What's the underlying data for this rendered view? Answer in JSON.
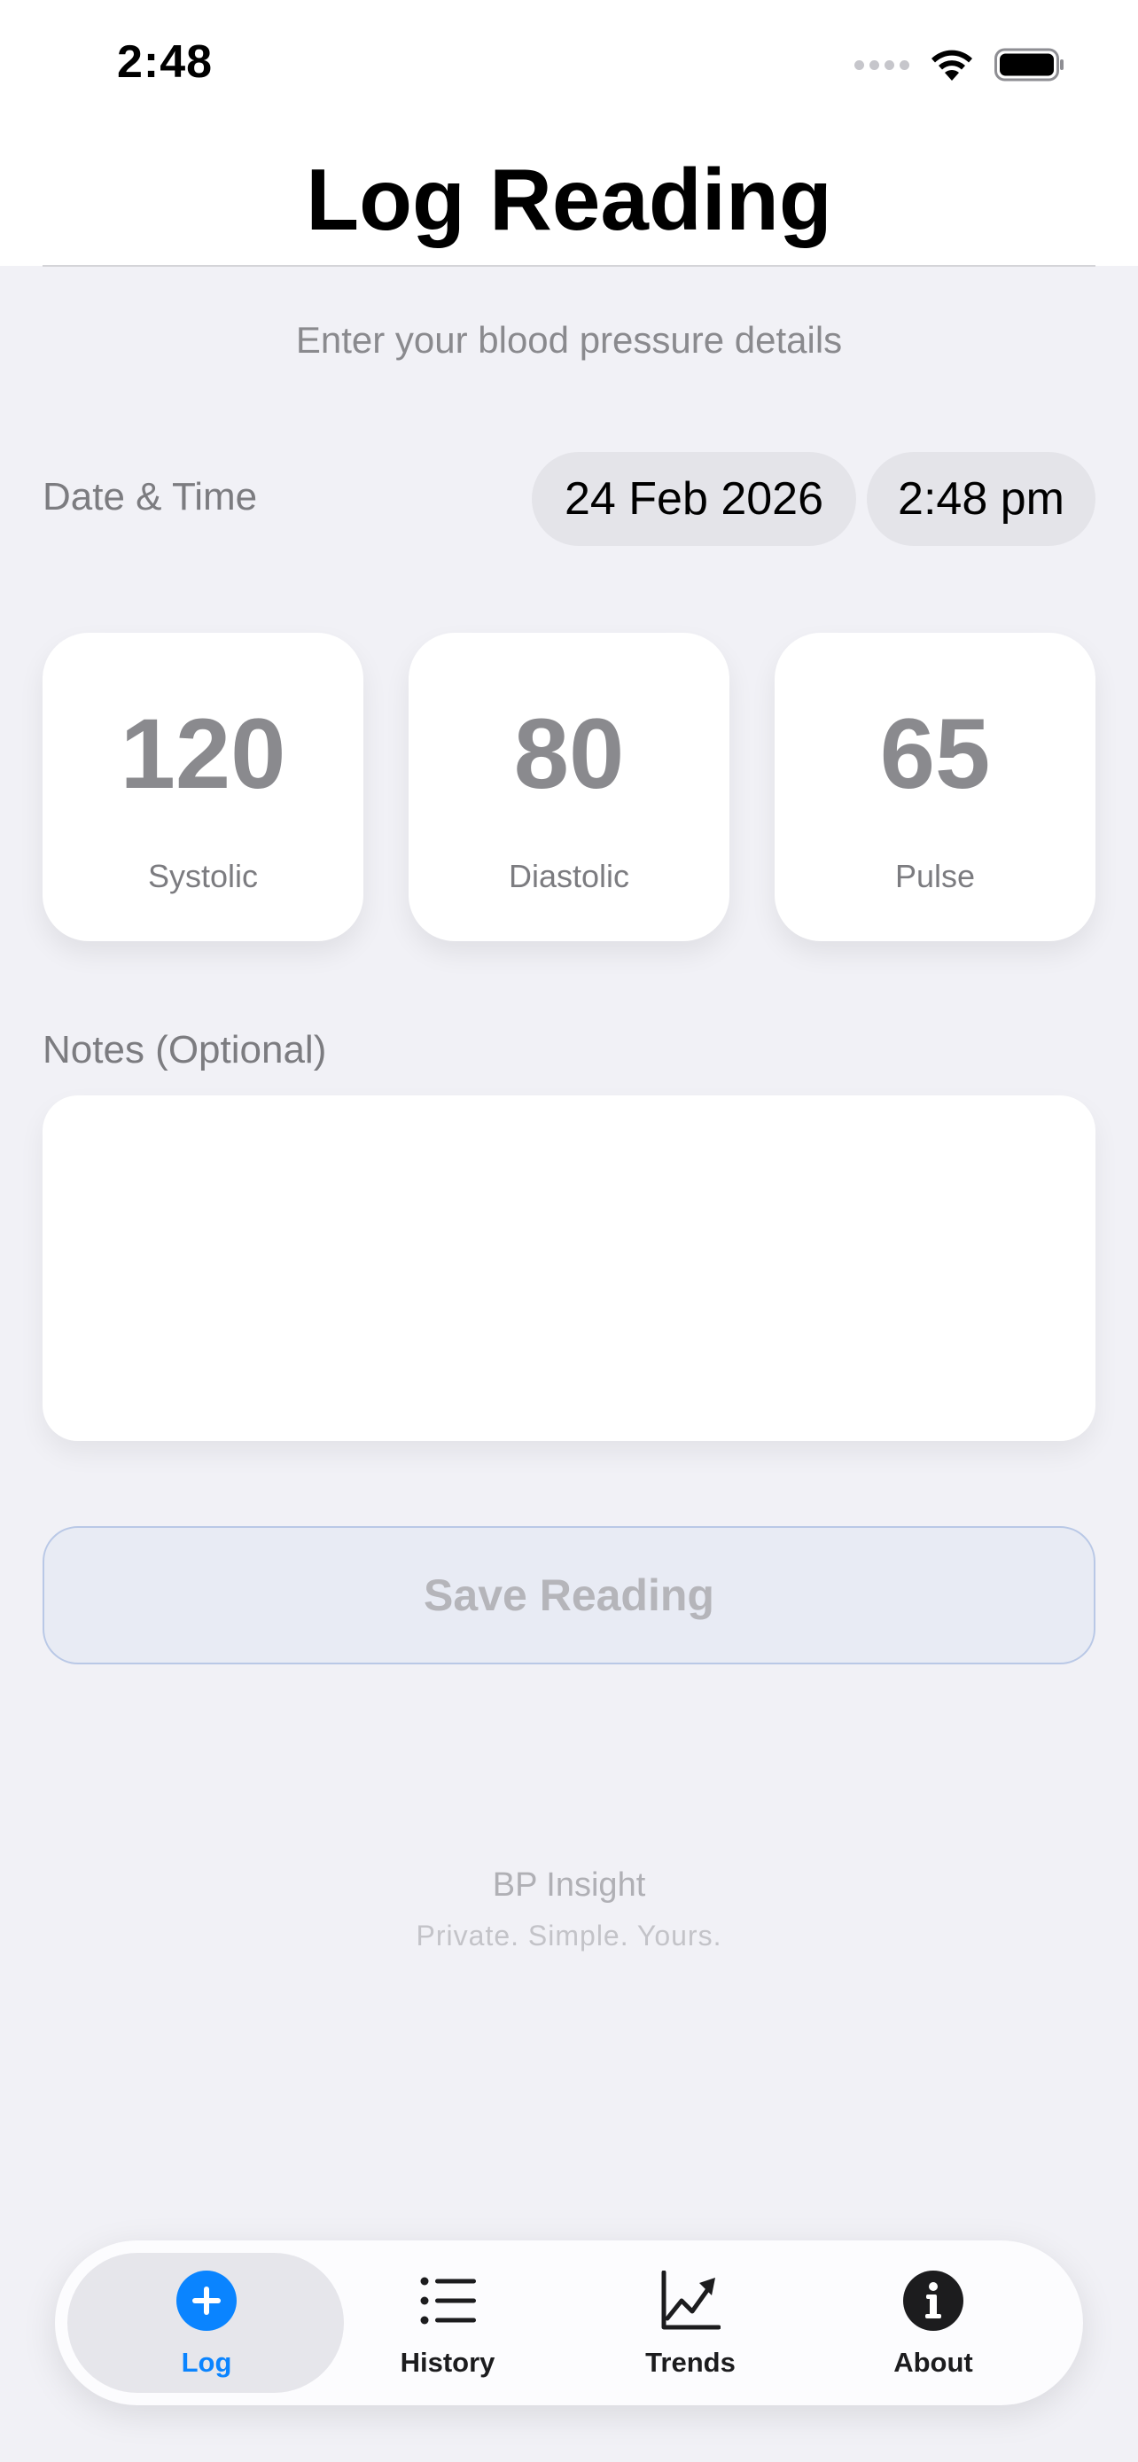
{
  "status_bar": {
    "time": "2:48"
  },
  "header": {
    "title": "Log Reading"
  },
  "form": {
    "subtitle": "Enter your blood pressure details",
    "datetime_label": "Date & Time",
    "date_value": "24 Feb 2026",
    "time_value": "2:48 pm",
    "metrics": [
      {
        "value": "120",
        "label": "Systolic"
      },
      {
        "value": "80",
        "label": "Diastolic"
      },
      {
        "value": "65",
        "label": "Pulse"
      }
    ],
    "notes_label": "Notes (Optional)",
    "notes_value": "",
    "save_label": "Save Reading"
  },
  "footer": {
    "brand": "BP Insight",
    "tagline": "Private. Simple. Yours."
  },
  "tab_bar": {
    "active": "Log",
    "tabs": [
      {
        "label": "Log",
        "icon": "plus-circle-icon"
      },
      {
        "label": "History",
        "icon": "list-icon"
      },
      {
        "label": "Trends",
        "icon": "chart-line-icon"
      },
      {
        "label": "About",
        "icon": "info-circle-icon"
      }
    ]
  },
  "colors": {
    "accent": "#0a84ff",
    "background": "#f1f1f6",
    "card": "#ffffff",
    "muted_text": "#8a8a8e"
  }
}
